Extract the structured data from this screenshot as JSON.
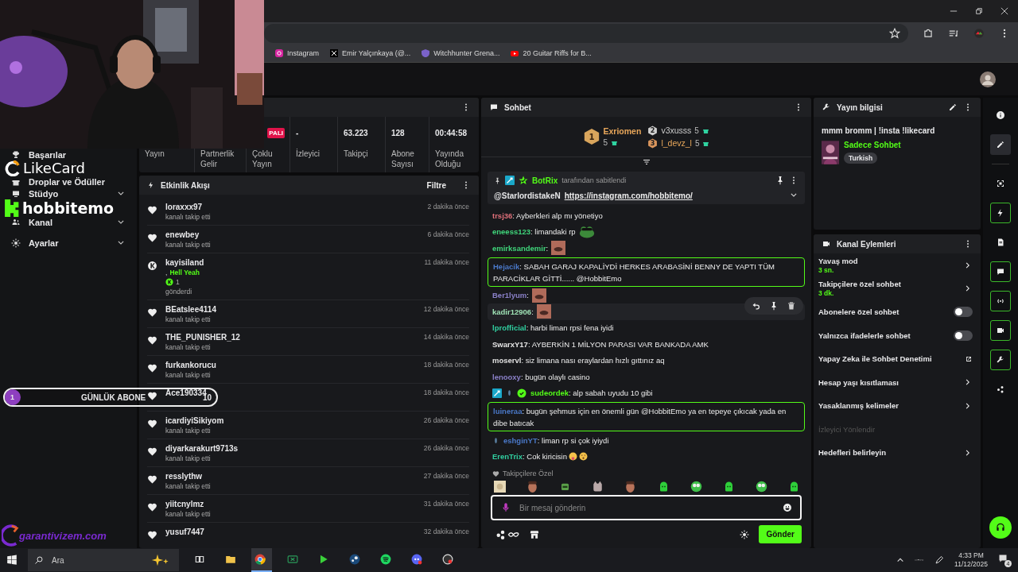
{
  "browser": {
    "bookmarks": [
      {
        "kind": "instagram",
        "label": "Instagram"
      },
      {
        "kind": "x",
        "label": "Emir Yalçınkaya (@..."
      },
      {
        "kind": "shield",
        "label": "Witchhunter Grena..."
      },
      {
        "kind": "youtube",
        "label": "20 Guitar Riffs for B..."
      }
    ]
  },
  "overlays": {
    "likecard": "LikeCard",
    "channel": "hobbitemo",
    "goal": {
      "count": "1",
      "label": "GÜNLÜK ABONE",
      "target": "10"
    },
    "sponsor": "garantivizem.com"
  },
  "sidebar": {
    "items": [
      {
        "kind": "trophy",
        "label": "Başarılar",
        "expandable": false
      },
      {
        "kind": "gift",
        "label": "Droplar ve Ödüller",
        "expandable": false
      },
      {
        "kind": "studio",
        "label": "Stüdyo",
        "expandable": true
      },
      {
        "kind": "people",
        "label": "Kanal",
        "expandable": true
      },
      {
        "kind": "gear",
        "label": "Ayarlar",
        "expandable": true
      }
    ]
  },
  "stats": [
    {
      "label": "Yayın"
    },
    {
      "label": "Partnerlik Gelir"
    },
    {
      "label": "Çoklu Yayın",
      "badge": "PALI"
    },
    {
      "value": "-",
      "label": "İzleyici"
    },
    {
      "value": "63.223",
      "label": "Takipçi"
    },
    {
      "value": "128",
      "label": "Abone Sayısı"
    },
    {
      "value": "00:44:58",
      "label": "Yayında Olduğu"
    }
  ],
  "activity": {
    "title": "Etkinlik Akışı",
    "filter": "Filtre",
    "events": [
      {
        "kind": "follow",
        "user": "loraxxx97",
        "action": "kanalı takip etti",
        "time": "2 dakika önce"
      },
      {
        "kind": "follow",
        "user": "enewbey",
        "action": "kanalı takip etti",
        "time": "6 dakika önce"
      },
      {
        "kind": "gift",
        "user": "kayisiland",
        "joiner": ",",
        "gift": "Hell Yeah",
        "amount": "1",
        "action": "gönderdi",
        "time": "11 dakika önce"
      },
      {
        "kind": "follow",
        "user": "BEatslee4114",
        "action": "kanalı takip etti",
        "time": "12 dakika önce"
      },
      {
        "kind": "follow",
        "user": "THE_PUNISHER_12",
        "action": "kanalı takip etti",
        "time": "14 dakika önce"
      },
      {
        "kind": "follow",
        "user": "furkankorucu",
        "action": "kanalı takip etti",
        "time": "18 dakika önce"
      },
      {
        "kind": "follow",
        "user": "Ace190334",
        "time": "18 dakika önce"
      },
      {
        "kind": "follow",
        "user": "icardiyiSikiyom",
        "action": "kanalı takip etti",
        "time": "26 dakika önce"
      },
      {
        "kind": "follow",
        "user": "diyarkarakurt9713s",
        "action": "kanalı takip etti",
        "time": "26 dakika önce"
      },
      {
        "kind": "follow",
        "user": "resslythw",
        "action": "kanalı takip etti",
        "time": "27 dakika önce"
      },
      {
        "kind": "follow",
        "user": "yiitcnylmz",
        "action": "kanalı takip etti",
        "time": "31 dakika önce"
      },
      {
        "kind": "follow",
        "user": "yusuf7447",
        "time": "32 dakika önce"
      }
    ]
  },
  "chat": {
    "title": "Sohbet",
    "leaders": [
      {
        "rank": "1",
        "name": "Exriomen",
        "count": "5"
      },
      {
        "rank": "2",
        "name": "v3xusss",
        "count": "5"
      },
      {
        "rank": "3",
        "name": "l_devz_l",
        "count": "5"
      }
    ],
    "pinned": {
      "by": "BotRix",
      "note": "tarafından sabitlendi",
      "mention": "@StarlordistakeN",
      "link": "https://instagram.com/hobbitemo/"
    },
    "messages": [
      {
        "user": "trsj36",
        "color": "#e0707a",
        "text": ": Ayberkleri alp mı yönetiyo",
        "highlighted": false,
        "hovered": false
      },
      {
        "user": "eneess123",
        "color": "#3fd47a",
        "text": ": limandaki rp",
        "emote": {
          "kind": "frog"
        },
        "highlighted": false,
        "hovered": false
      },
      {
        "user": "emirksandemir",
        "color": "#3fd47a",
        "text": ":",
        "emote": {
          "kind": "face"
        },
        "highlighted": false,
        "hovered": false
      },
      {
        "user": "Hejacik",
        "color": "#4a78c8",
        "text": ": SABAH GARAJ KAPALİYDİ HERKES ARABASİNİ BENNY DE YAPTI TÜM PARACİKLAR GİTTİ...... @HobbitEmo",
        "highlighted": true,
        "hovered": false
      },
      {
        "user": "Ber1lyum",
        "color": "#8a80c8",
        "text": ":",
        "emote": {
          "kind": "face"
        },
        "highlighted": false,
        "hovered": false
      },
      {
        "user": "kadir12906",
        "color": "#9ee0b4",
        "text": ":",
        "emote": {
          "kind": "face"
        },
        "highlighted": false,
        "hovered": true
      },
      {
        "user": "lprofficial",
        "color": "#30cfa0",
        "text": ": harbi liman rpsi fena iyidi",
        "highlighted": false,
        "hovered": false
      },
      {
        "user": "SwarxY17",
        "color": "#e6e6e6",
        "text": ": AYBERKİN 1 MİLYON PARASI VAR BANKADA AMK",
        "highlighted": false,
        "hovered": false
      },
      {
        "user": "moservl",
        "color": "#e0e0e0",
        "text": ": siz limana nası eraylardan hızlı gıttınız aq",
        "highlighted": false,
        "hovered": false
      },
      {
        "user": "lenooxy",
        "color": "#8a80c8",
        "text": ": bugün olaylı casino",
        "highlighted": false,
        "hovered": false
      },
      {
        "user": "sudeordek",
        "color": "#53fc18",
        "text": ": alp sabah uyudu 10 gibi",
        "badges": [
          {
            "kind": "mod"
          },
          {
            "kind": "sub"
          },
          {
            "kind": "verified"
          }
        ],
        "highlighted": false,
        "hovered": false
      },
      {
        "user": "luineraa",
        "color": "#4a78c8",
        "text": ": bugün şehmus için en önemli gün @HobbitEmo ya en tepeye çıkıcak yada en dibe batıcak",
        "highlighted": true,
        "hovered": false
      },
      {
        "user": "eshginYT",
        "color": "#4a78c8",
        "text": ": liman rp si çok iyiydi",
        "badges": [
          {
            "kind": "sub"
          }
        ],
        "highlighted": false,
        "hovered": false
      },
      {
        "user": "ErenTrix",
        "color": "#30cfa0",
        "text": ": Cok kiricisin",
        "emote": {
          "kind": "emojis"
        },
        "highlighted": false,
        "hovered": false
      }
    ],
    "emote_section": "Takipçilere Özel",
    "emotes": [
      {
        "kind": "sand"
      },
      {
        "kind": "face"
      },
      {
        "kind": "square"
      },
      {
        "kind": "cat"
      },
      {
        "kind": "face"
      },
      {
        "kind": "blob"
      },
      {
        "kind": "ball"
      },
      {
        "kind": "blob"
      },
      {
        "kind": "ball"
      },
      {
        "kind": "blob"
      }
    ],
    "input": {
      "placeholder": "Bir mesaj gönderin"
    },
    "send": "Gönder"
  },
  "info": {
    "title": "Yayın bilgisi",
    "stream_title": "mmm bromm | !insta !likecard",
    "category": "Sadece Sohbet",
    "tag": "Turkish"
  },
  "actions": {
    "title": "Kanal Eylemleri",
    "items": [
      {
        "kind": "menu",
        "label": "Yavaş mod",
        "value": "3 sn."
      },
      {
        "kind": "menu",
        "label": "Takipçilere özel sohbet",
        "value": "3 dk."
      },
      {
        "kind": "toggle",
        "label": "Abonelere özel sohbet",
        "on": false
      },
      {
        "kind": "toggle",
        "label": "Yalnızca ifadelerle sohbet",
        "on": false
      },
      {
        "kind": "link",
        "label": "Yapay Zeka ile Sohbet Denetimi"
      },
      {
        "kind": "menu",
        "label": "Hesap yaşı kısıtlaması"
      },
      {
        "kind": "menu",
        "label": "Yasaklanmış kelimeler"
      },
      {
        "kind": "disabled",
        "label": "İzleyici Yönlendir"
      },
      {
        "kind": "menu",
        "label": "Hedefleri belirleyin"
      }
    ]
  },
  "rail": [
    {
      "kind": "info",
      "selected": false,
      "outlined": false
    },
    {
      "kind": "pencil",
      "selected": true,
      "outlined": false
    },
    {
      "kind": "frame",
      "selected": false,
      "outlined": false
    },
    {
      "kind": "bolt",
      "selected": false,
      "outlined": true
    },
    {
      "kind": "doc",
      "selected": false,
      "outlined": false
    },
    {
      "kind": "chat",
      "selected": false,
      "outlined": true
    },
    {
      "kind": "broadcast",
      "selected": false,
      "outlined": true
    },
    {
      "kind": "video",
      "selected": false,
      "outlined": true
    },
    {
      "kind": "wrench",
      "selected": false,
      "outlined": true
    },
    {
      "kind": "nodes",
      "selected": false,
      "outlined": false
    }
  ],
  "taskbar": {
    "search": "Ara",
    "apps": [
      {
        "kind": "taskview",
        "active": false
      },
      {
        "kind": "folder",
        "active": false
      },
      {
        "kind": "chrome",
        "active": true
      },
      {
        "kind": "xbox",
        "active": false
      },
      {
        "kind": "play",
        "active": false
      },
      {
        "kind": "steam",
        "active": false
      },
      {
        "kind": "spotify",
        "active": false
      },
      {
        "kind": "discord",
        "active": false
      },
      {
        "kind": "record",
        "active": false
      }
    ],
    "time": "4:33 PM",
    "date": "11/12/2025",
    "notifications": "4"
  }
}
